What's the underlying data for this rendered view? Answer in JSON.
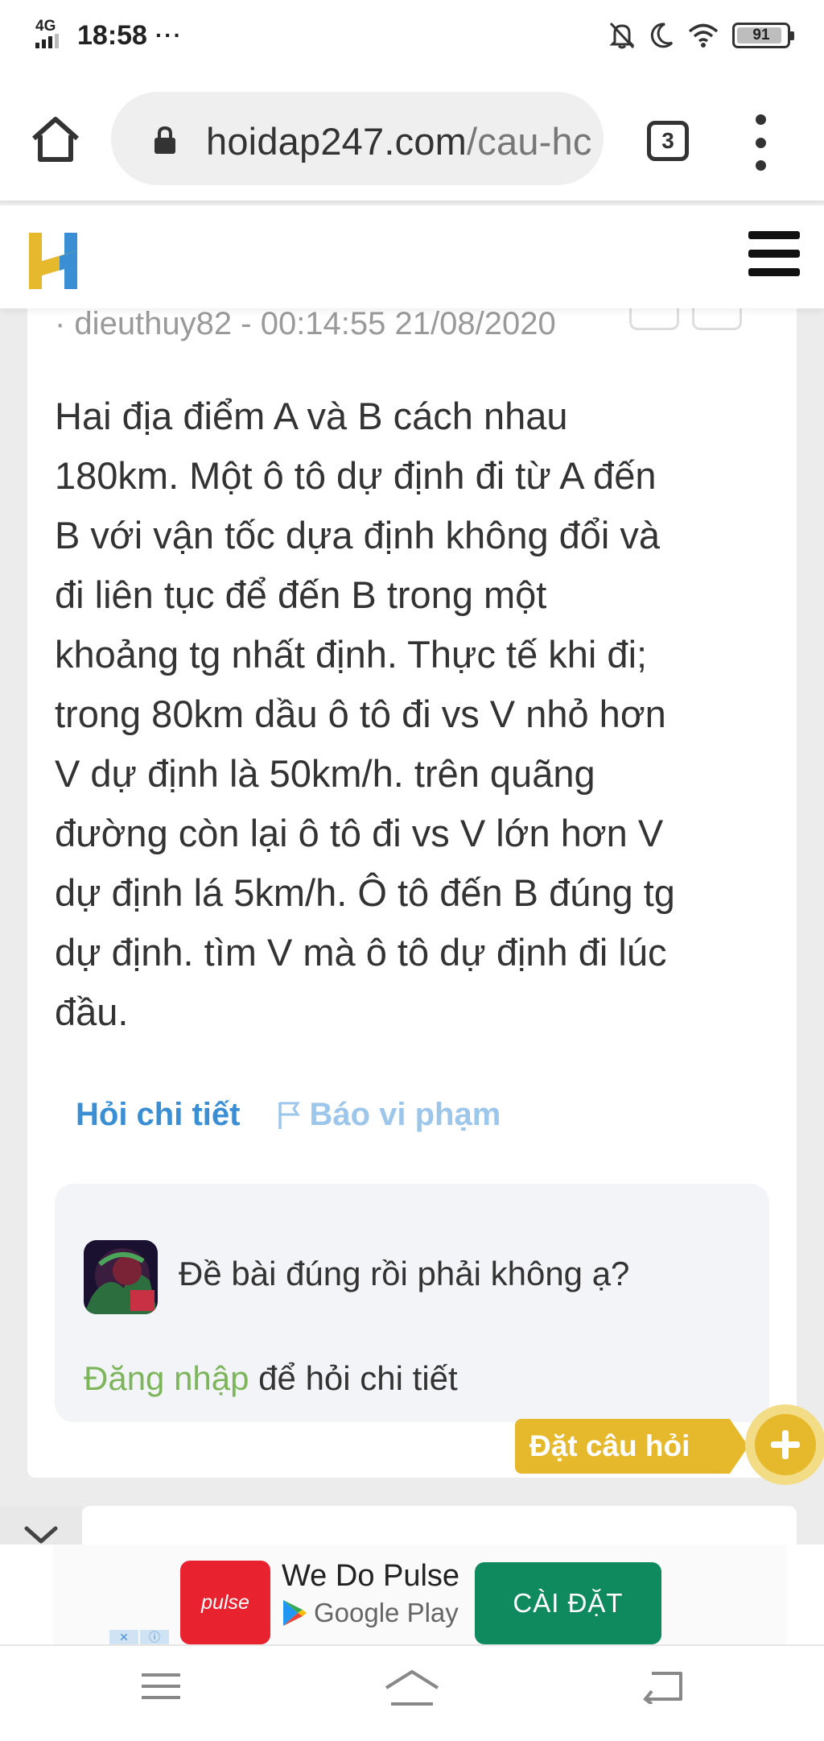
{
  "status_bar": {
    "network": "4G",
    "time": "18:58",
    "more": "···",
    "battery_level": "91",
    "battery_fraction": 0.91
  },
  "browser": {
    "url_host": "hoidap247.com",
    "url_path": "/cau-hc",
    "tab_count": "3"
  },
  "site": {
    "logo_letter": "H",
    "brand_blue": "#3a8fd4",
    "brand_yellow": "#e6b92d"
  },
  "question": {
    "meta": "· dieuthuy82 - 00:14:55 21/08/2020",
    "text": "Hai địa điểm A và B cách nhau\n180km. Một ô tô dự định đi từ A đến\nB với vận tốc dựa định không đổi và\nđi liên tục để đến B trong một\nkhoảng tg nhất định. Thực tế khi đi;\ntrong 80km dầu ô tô đi vs V nhỏ hơn\nV dự định  là 50km/h. trên quãng\nđường còn lại ô tô đi vs V lớn hơn V\ndự định lá 5km/h. Ô tô đến B đúng tg\ndự định. tìm V mà ô tô dự định đi lúc\nđầu.",
    "ask_detail": "Hỏi chi tiết",
    "report": "Báo vi phạm"
  },
  "comment": {
    "text": "Đề bài đúng rồi phải không ạ?",
    "login_link": "Đăng nhập",
    "login_suffix": " để hỏi chi tiết"
  },
  "fab": {
    "label": "Đặt câu hỏi"
  },
  "ad": {
    "logo_text": "pulse",
    "title": "We Do Pulse",
    "store": "Google Play",
    "cta": "CÀI ĐẶT"
  },
  "icons": {
    "home": "home-icon",
    "lock": "lock-icon",
    "menu": "more-vert-icon",
    "hamburger": "hamburger-icon",
    "flag": "flag-icon",
    "plus": "plus-icon",
    "chevron": "chevron-down-icon"
  }
}
